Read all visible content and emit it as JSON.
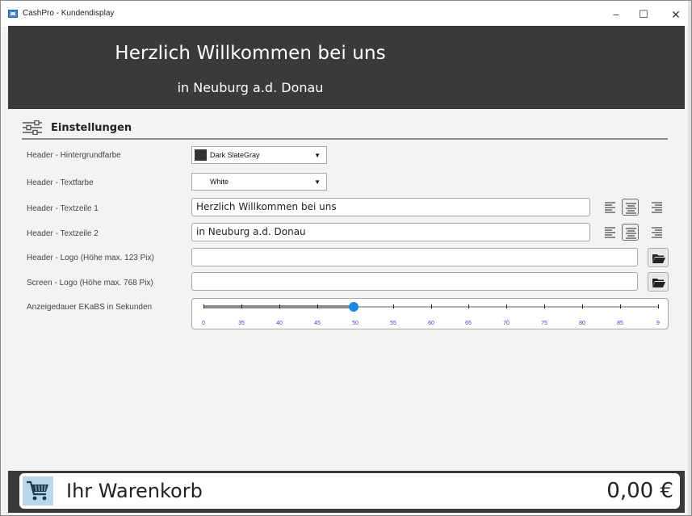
{
  "window": {
    "title": "CashPro - Kundendisplay",
    "minimize": "–",
    "maximize": "☐",
    "close": "✕"
  },
  "header": {
    "line1": "Herzlich Willkommen bei uns",
    "line2": "in Neuburg a.d. Donau",
    "background": "#3a3a3a",
    "text_color": "#ffffff"
  },
  "settings": {
    "title": "Einstellungen",
    "bg_color": {
      "label": "Header - Hintergrundfarbe",
      "value": "Dark SlateGray",
      "swatch": "#333333",
      "arrow": "▼"
    },
    "text_color": {
      "label": "Header - Textfarbe",
      "value": "White",
      "swatch": "#ffffff",
      "arrow": "▼"
    },
    "line1": {
      "label": "Header - Textzeile 1",
      "value": "Herzlich Willkommen bei uns",
      "alignment": "center"
    },
    "line2": {
      "label": "Header - Textzeile 2",
      "value": "in Neuburg a.d. Donau",
      "alignment": "center"
    },
    "header_logo": {
      "label": "Header - Logo (Höhe max. 123 Pix)",
      "value": ""
    },
    "screen_logo": {
      "label": "Screen - Logo (Höhe max. 768 Pix)",
      "value": ""
    },
    "duration": {
      "label": "Anzeigedauer EKaBS in Sekunden",
      "value": 50,
      "ticks": [
        "0",
        "35",
        "40",
        "45",
        "50",
        "55",
        "60",
        "65",
        "70",
        "75",
        "80",
        "85",
        "9"
      ]
    }
  },
  "footer": {
    "cart_label": "Ihr Warenkorb",
    "total": "0,00 €"
  },
  "icons": {
    "app": "app-icon",
    "settings": "settings-sliders-icon",
    "align_left": "align-left-icon",
    "align_center": "align-center-icon",
    "align_right": "align-right-icon",
    "folder": "folder-open-icon",
    "cart": "shopping-cart-icon"
  }
}
